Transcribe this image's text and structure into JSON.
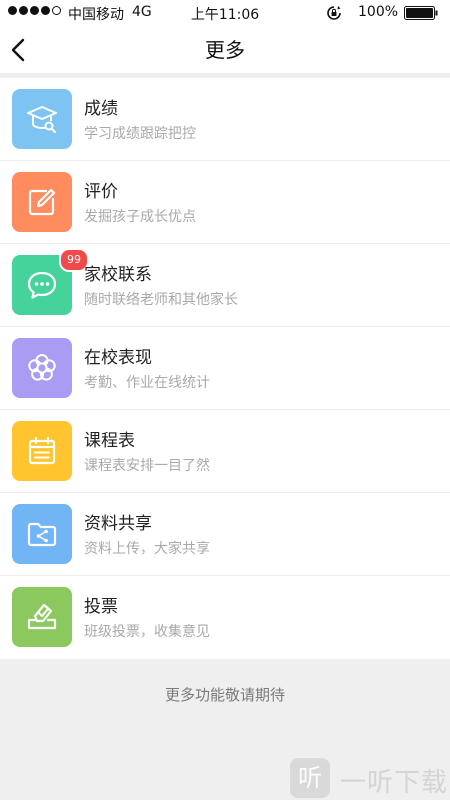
{
  "status_bar": {
    "carrier": "中国移动",
    "network": "4G",
    "time": "上午11:06",
    "battery_percent": "100%",
    "signal_bars_filled": 4,
    "signal_bars_total": 5
  },
  "nav": {
    "title": "更多",
    "back_icon": "chevron-left-icon"
  },
  "menu": [
    {
      "label": "成绩",
      "desc": "学习成绩跟踪把控",
      "color": "#7ec4f2",
      "icon": "graduation-cap-search-icon"
    },
    {
      "label": "评价",
      "desc": "发掘孩子成长优点",
      "color": "#ff8c5f",
      "icon": "edit-note-icon"
    },
    {
      "label": "家校联系",
      "desc": "随时联络老师和其他家长",
      "color": "#45d39b",
      "icon": "chat-bubble-icon",
      "badge": "99"
    },
    {
      "label": "在校表现",
      "desc": "考勤、作业在线统计",
      "color": "#a99cf2",
      "icon": "flower-icon"
    },
    {
      "label": "课程表",
      "desc": "课程表安排一目了然",
      "color": "#ffc42e",
      "icon": "calendar-icon"
    },
    {
      "label": "资料共享",
      "desc": "资料上传，大家共享",
      "color": "#72b5f5",
      "icon": "shared-folder-icon"
    },
    {
      "label": "投票",
      "desc": "班级投票，收集意见",
      "color": "#8bc95f",
      "icon": "ballot-box-icon"
    }
  ],
  "footer_note": "更多功能敬请期待",
  "watermark": {
    "logo_char": "听",
    "text": "一听下载"
  }
}
